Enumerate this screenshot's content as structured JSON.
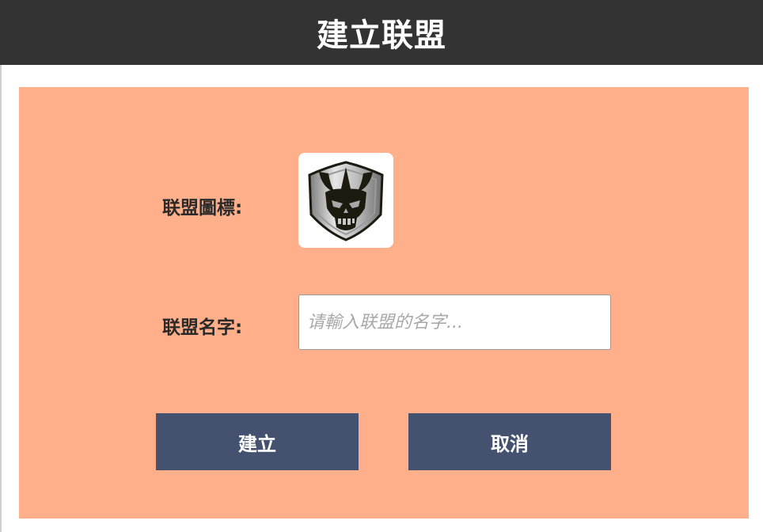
{
  "header": {
    "title": "建立联盟"
  },
  "form": {
    "emblem_label": "联盟圖標:",
    "name_label": "联盟名字:",
    "name_placeholder": "请輸入联盟的名字...",
    "name_value": ""
  },
  "buttons": {
    "create": "建立",
    "cancel": "取消"
  },
  "emblem": {
    "icon": "horned-skull-shield-icon"
  },
  "colors": {
    "header_bg": "#333333",
    "panel_bg": "#ffb08a",
    "button_bg": "#44526f"
  }
}
